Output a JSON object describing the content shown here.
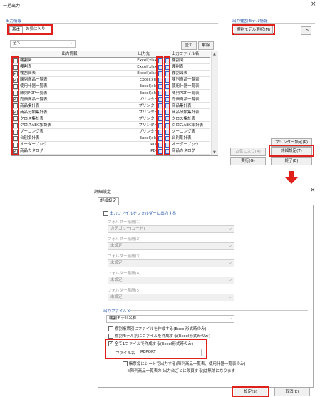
{
  "window1": {
    "title": "一括出力",
    "close": "×",
    "section_label": "出力情報",
    "tabs": [
      "基本",
      "お気に入り"
    ],
    "filter_value": "全て",
    "all_button": "全て",
    "clear_button": "解除",
    "columns": [
      "出力情報",
      "出力先",
      "出力ファイル名"
    ],
    "rows": [
      {
        "name": "棚割図",
        "dest": "Excel(xlsx)",
        "file": "棚割図",
        "checked": false,
        "fcheck": false
      },
      {
        "name": "棚割表",
        "dest": "Excel(xlsx)",
        "file": "棚割表",
        "checked": false,
        "fcheck": false
      },
      {
        "name": "棚割図表",
        "dest": "Excel(xlsx)",
        "file": "棚割図表",
        "checked": true,
        "fcheck": false
      },
      {
        "name": "陳列商品一覧表",
        "dest": "Excel(xls)",
        "file": "陳列商品一覧表",
        "checked": true,
        "fcheck": false
      },
      {
        "name": "使用什器一覧表",
        "dest": "Excel(xls)",
        "file": "使用什器一覧表",
        "checked": false,
        "fcheck": false
      },
      {
        "name": "陳列POP一覧表",
        "dest": "Excel(xls)",
        "file": "陳列POP一覧表",
        "checked": false,
        "fcheck": false
      },
      {
        "name": "売価商品一覧表",
        "dest": "プリンター",
        "file": "売価商品一覧表",
        "checked": true,
        "fcheck": false
      },
      {
        "name": "商品集計表",
        "dest": "プリンター",
        "file": "商品集計表",
        "checked": false,
        "fcheck": false
      },
      {
        "name": "商品分類集計表",
        "dest": "プリンター",
        "file": "商品分類集計表",
        "checked": true,
        "fcheck": false
      },
      {
        "name": "クロス集計表",
        "dest": "プリンター",
        "file": "クロス集計表",
        "checked": false,
        "fcheck": false
      },
      {
        "name": "クロスABC集計表",
        "dest": "プリンター",
        "file": "クロスABC集計表",
        "checked": false,
        "fcheck": false
      },
      {
        "name": "ゾーニング表",
        "dest": "プリンター",
        "file": "ゾーニング表",
        "checked": false,
        "fcheck": false
      },
      {
        "name": "台別集計表",
        "dest": "Excel(xls)",
        "file": "台別集計表",
        "checked": false,
        "fcheck": false
      },
      {
        "name": "オーダーブック",
        "dest": "PDF",
        "file": "オーダーブック",
        "checked": false,
        "fcheck": false
      },
      {
        "name": "商品カタログ",
        "dest": "PDF",
        "file": "商品カタログ",
        "checked": true,
        "fcheck": false
      }
    ],
    "model_section_label": "出力棚割モデル情報",
    "model_select_button": "棚割モデル選択(M)",
    "model_count": "5",
    "printer_settings": "プリンター設定(P)",
    "detail_settings": "詳細設定(T)",
    "favorite_register": "お気に入り(A)",
    "execute": "実行(G)",
    "finish": "終了(E)"
  },
  "window2": {
    "title": "詳細設定",
    "close": "×",
    "tab": "詳細設定",
    "folder_option": "出力ファイルをフォルダーに出力する",
    "levels": [
      {
        "label": "フォルダー階層(1)",
        "value": "カテゴリー(コード)"
      },
      {
        "label": "フォルダー階層(2)",
        "value": "未設定"
      },
      {
        "label": "フォルダー階層(3)",
        "value": "未設定"
      },
      {
        "label": "フォルダー階層(4)",
        "value": "未設定"
      },
      {
        "label": "フォルダー階層(5)",
        "value": "未設定"
      }
    ],
    "filename_section": "出力ファイル名",
    "filename_select": "棚割モデル名称",
    "opt1": "棚割帳票別にファイルを作成する(Excel形式時のみ)",
    "opt2": "棚割モデル別にファイルを作成する(Excel形式時のみ)",
    "opt3": "全て1ファイルで作成する(Excel形式時のみ)",
    "filename_label": "ファイル名",
    "filename_value": "REPORT",
    "opt4": "帳票毎にシートで出力する(陳列商品一覧表、使用什器一覧表のみ)",
    "note": "※陳列商品一覧表の[出力台ごとに改頁する]は無効になります",
    "ok": "設定(S)",
    "cancel": "取消(E)"
  },
  "colors": {
    "highlight": "#e0201a",
    "section": "#2255aa"
  }
}
